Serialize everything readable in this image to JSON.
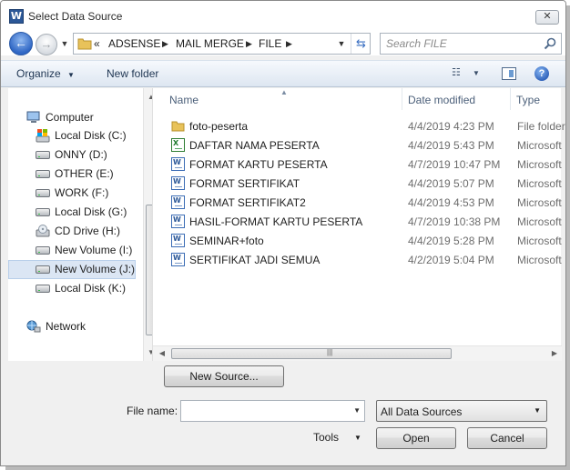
{
  "window": {
    "title": "Select Data Source",
    "app_icon_letter": "W"
  },
  "nav": {
    "breadcrumb_prefix": "«",
    "breadcrumb": [
      "ADSENSE",
      "MAIL MERGE",
      "FILE"
    ],
    "search_placeholder": "Search FILE"
  },
  "toolbar": {
    "organize": "Organize",
    "new_folder": "New folder"
  },
  "sidebar": {
    "computer": "Computer",
    "drives": [
      {
        "label": "Local Disk (C:)",
        "icon": "system-drive-icon"
      },
      {
        "label": "ONNY (D:)",
        "icon": "hard-drive-icon"
      },
      {
        "label": "OTHER (E:)",
        "icon": "hard-drive-icon"
      },
      {
        "label": "WORK (F:)",
        "icon": "hard-drive-icon"
      },
      {
        "label": "Local Disk (G:)",
        "icon": "hard-drive-icon"
      },
      {
        "label": "CD Drive (H:)",
        "icon": "cd-drive-icon"
      },
      {
        "label": "New Volume (I:)",
        "icon": "hard-drive-icon"
      },
      {
        "label": "New Volume (J:)",
        "icon": "hard-drive-icon",
        "selected": true
      },
      {
        "label": "Local Disk (K:)",
        "icon": "hard-drive-icon"
      }
    ],
    "network": "Network"
  },
  "files": {
    "columns": {
      "name": "Name",
      "date": "Date modified",
      "type": "Type"
    },
    "rows": [
      {
        "name": "foto-peserta",
        "date": "4/4/2019 4:23 PM",
        "type": "File folder",
        "icon": "folder-icon"
      },
      {
        "name": "DAFTAR NAMA PESERTA",
        "date": "4/4/2019 5:43 PM",
        "type": "Microsoft",
        "icon": "excel-file-icon"
      },
      {
        "name": "FORMAT KARTU PESERTA",
        "date": "4/7/2019 10:47 PM",
        "type": "Microsoft",
        "icon": "word-file-icon"
      },
      {
        "name": "FORMAT SERTIFIKAT",
        "date": "4/4/2019 5:07 PM",
        "type": "Microsoft",
        "icon": "word-file-icon"
      },
      {
        "name": "FORMAT SERTIFIKAT2",
        "date": "4/4/2019 4:53 PM",
        "type": "Microsoft",
        "icon": "word-file-icon"
      },
      {
        "name": "HASIL-FORMAT KARTU PESERTA",
        "date": "4/7/2019 10:38 PM",
        "type": "Microsoft",
        "icon": "word-file-icon"
      },
      {
        "name": "SEMINAR+foto",
        "date": "4/4/2019 5:28 PM",
        "type": "Microsoft",
        "icon": "word-file-icon"
      },
      {
        "name": "SERTIFIKAT JADI  SEMUA",
        "date": "4/2/2019 5:04 PM",
        "type": "Microsoft",
        "icon": "word-file-icon"
      }
    ]
  },
  "bottom": {
    "new_source": "New Source...",
    "file_name_label": "File name:",
    "file_name_value": "",
    "file_type": "All Data Sources",
    "tools": "Tools",
    "open": "Open",
    "cancel": "Cancel"
  },
  "colors": {
    "accent": "#2f66c4",
    "selected_bg": "#dbe6f4",
    "toolbar_text": "#1e3552",
    "folder": "#e8c25a"
  }
}
